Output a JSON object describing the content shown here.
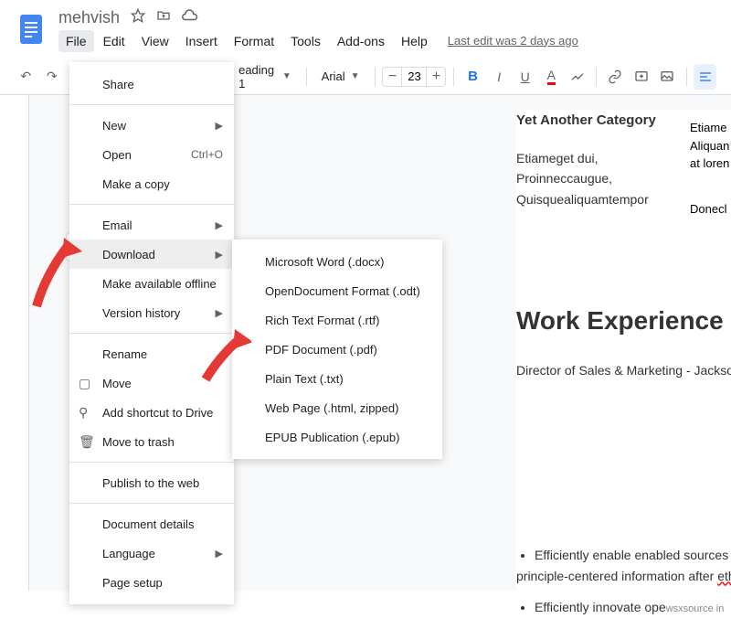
{
  "header": {
    "title": "mehvish",
    "lastEdit": "Last edit was 2 days ago"
  },
  "menubar": [
    "File",
    "Edit",
    "View",
    "Insert",
    "Format",
    "Tools",
    "Add-ons",
    "Help"
  ],
  "toolbar": {
    "styleSelect": "eading 1",
    "fontSelect": "Arial",
    "fontSize": "23"
  },
  "fileMenu": {
    "share": "Share",
    "new": "New",
    "open": "Open",
    "openShortcut": "Ctrl+O",
    "makeCopy": "Make a copy",
    "email": "Email",
    "download": "Download",
    "makeOffline": "Make available offline",
    "versionHistory": "Version history",
    "rename": "Rename",
    "move": "Move",
    "addShortcut": "Add shortcut to Drive",
    "trash": "Move to trash",
    "publish": "Publish to the web",
    "docDetails": "Document details",
    "language": "Language",
    "pageSetup": "Page setup"
  },
  "downloadMenu": [
    "Microsoft Word (.docx)",
    "OpenDocument Format (.odt)",
    "Rich Text Format (.rtf)",
    "PDF Document (.pdf)",
    "Plain Text (.txt)",
    "Web Page (.html, zipped)",
    "EPUB Publication (.epub)"
  ],
  "document": {
    "categoryHeading": "Yet Another Category",
    "categoryBody": "Etiameget dui, Proinneccaugue, Quisquealiquamtempor",
    "sideText1": "Etiame",
    "sideText2": "Aliquan",
    "sideText3": "at loren",
    "sideText4": "Donecl",
    "workExp": "Work Experience",
    "director": "Director of Sales & Marketing - Jackso",
    "bullet1a": "Efficiently enable enabled sources",
    "bullet1b": "principle-centered information after ",
    "bullet1typo": "eth",
    "bullet2": "Efficiently innovate ope",
    "watermark": "wsxsource in"
  }
}
